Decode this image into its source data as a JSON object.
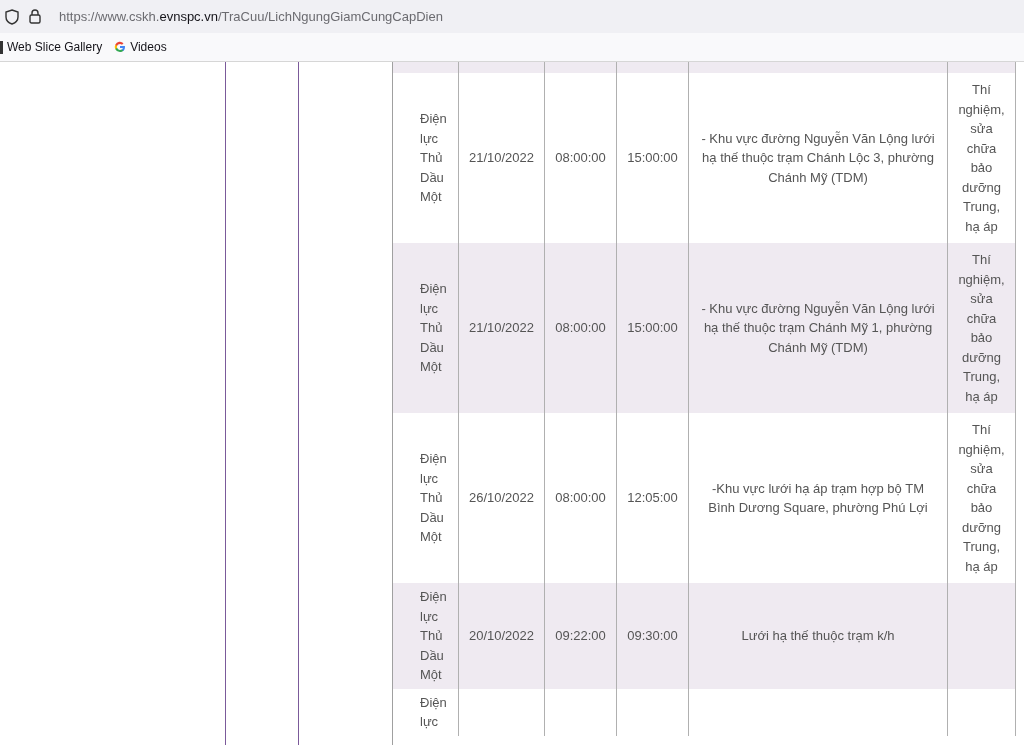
{
  "address_bar": {
    "url_prefix": "https://www.cskh.",
    "url_domain": "evnspc.vn",
    "url_path": "/TraCuu/LichNgungGiamCungCapDien"
  },
  "bookmarks": [
    {
      "label": "Web Slice Gallery",
      "kind": "folder"
    },
    {
      "label": "Videos",
      "kind": "google"
    }
  ],
  "table": {
    "rows": [
      {
        "unit": "Điện lực Thủ Dầu Một",
        "date": "21/10/2022",
        "start": "08:00:00",
        "end": "15:00:00",
        "area": "- Khu vực đường Nguyễn Văn Lộng lưới hạ thế thuộc trạm Chánh Lộc 3, phường Chánh Mỹ (TDM)",
        "reason": "Thí nghiệm, sửa chữa bảo dưỡng Trung, hạ áp"
      },
      {
        "unit": "Điện lực Thủ Dầu Một",
        "date": "21/10/2022",
        "start": "08:00:00",
        "end": "15:00:00",
        "area": "- Khu vực đường Nguyễn Văn Lộng lưới hạ thế thuộc trạm Chánh Mỹ 1, phường Chánh Mỹ (TDM)",
        "reason": "Thí nghiệm, sửa chữa bảo dưỡng Trung, hạ áp"
      },
      {
        "unit": "Điện lực Thủ Dầu Một",
        "date": "26/10/2022",
        "start": "08:00:00",
        "end": "12:05:00",
        "area": "-Khu vực lưới hạ áp trạm hợp bộ TM Bình Dương Square, phường Phú Lợi",
        "reason": "Thí nghiệm, sửa chữa bảo dưỡng Trung, hạ áp"
      },
      {
        "unit": "Điện lực Thủ Dầu Một",
        "date": "20/10/2022",
        "start": "09:22:00",
        "end": "09:30:00",
        "area": "Lưới hạ thế thuộc trạm k/h"
      },
      {
        "unit": "Điện lực"
      }
    ]
  }
}
